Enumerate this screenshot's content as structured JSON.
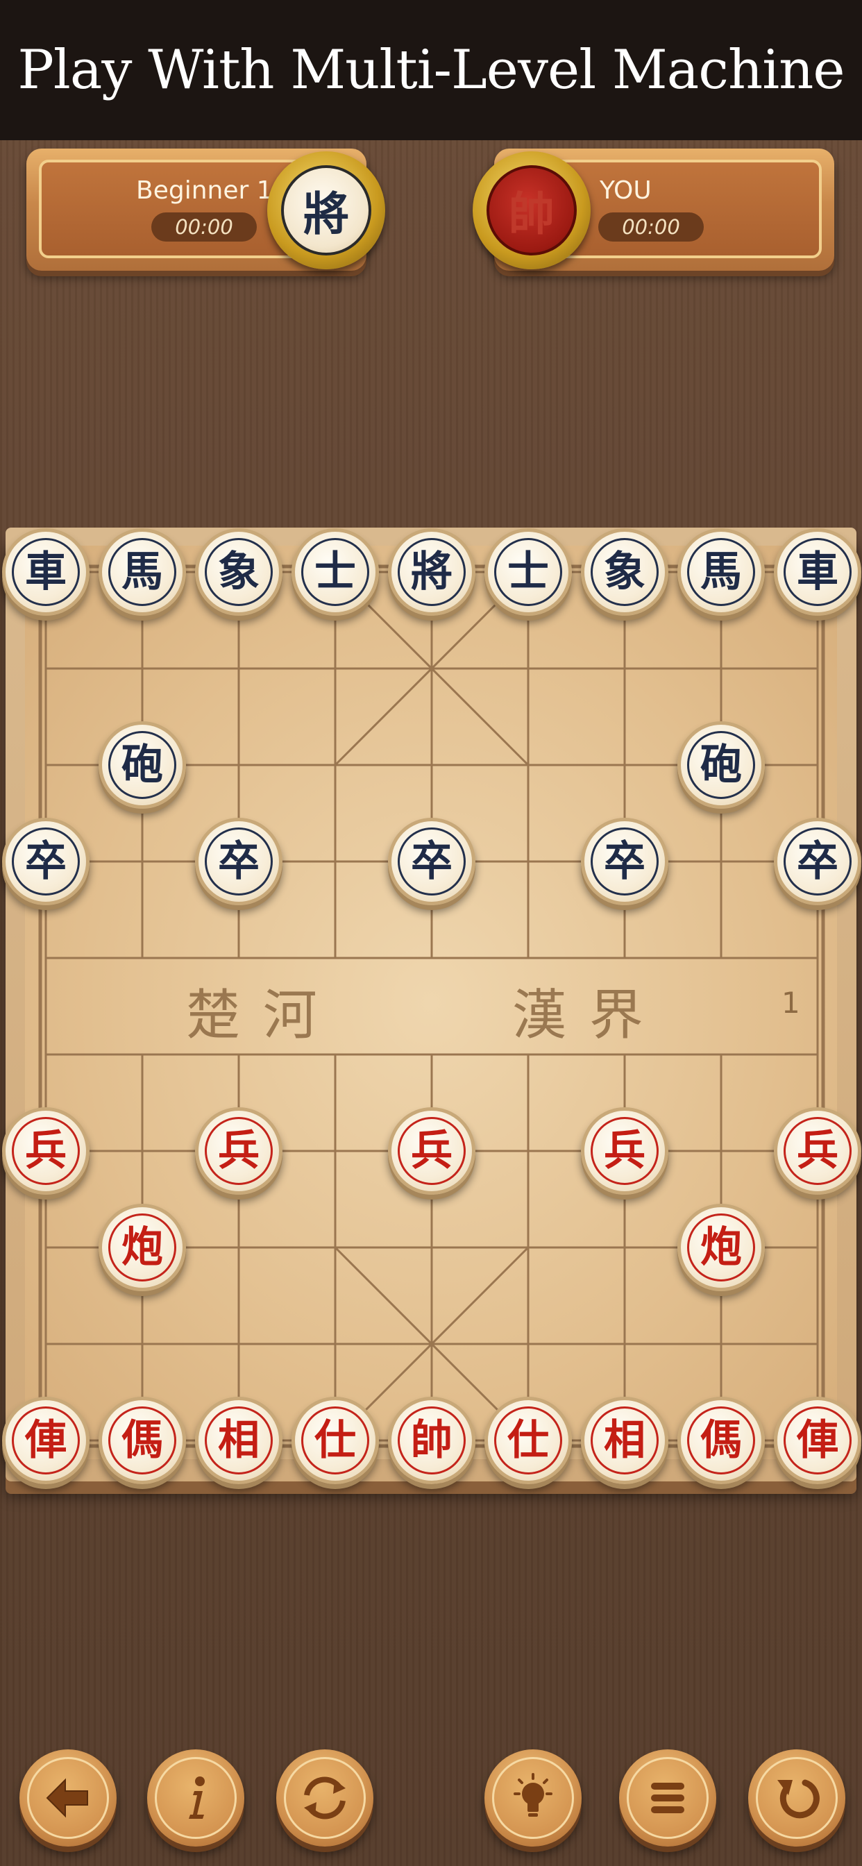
{
  "banner": {
    "title": "Play With Multi-Level Machine"
  },
  "opponent": {
    "name": "Beginner 1",
    "timer": "00:00",
    "avatar_char": "將"
  },
  "player": {
    "name": "YOU",
    "timer": "00:00",
    "avatar_char": "帥"
  },
  "board": {
    "river_left": "楚 河",
    "river_right": "漢 界",
    "move_count": "1",
    "pieces": [
      {
        "side": "black",
        "char": "車",
        "col": 0,
        "row": 0
      },
      {
        "side": "black",
        "char": "馬",
        "col": 1,
        "row": 0
      },
      {
        "side": "black",
        "char": "象",
        "col": 2,
        "row": 0
      },
      {
        "side": "black",
        "char": "士",
        "col": 3,
        "row": 0
      },
      {
        "side": "black",
        "char": "將",
        "col": 4,
        "row": 0
      },
      {
        "side": "black",
        "char": "士",
        "col": 5,
        "row": 0
      },
      {
        "side": "black",
        "char": "象",
        "col": 6,
        "row": 0
      },
      {
        "side": "black",
        "char": "馬",
        "col": 7,
        "row": 0
      },
      {
        "side": "black",
        "char": "車",
        "col": 8,
        "row": 0
      },
      {
        "side": "black",
        "char": "砲",
        "col": 1,
        "row": 2
      },
      {
        "side": "black",
        "char": "砲",
        "col": 7,
        "row": 2
      },
      {
        "side": "black",
        "char": "卒",
        "col": 0,
        "row": 3
      },
      {
        "side": "black",
        "char": "卒",
        "col": 2,
        "row": 3
      },
      {
        "side": "black",
        "char": "卒",
        "col": 4,
        "row": 3
      },
      {
        "side": "black",
        "char": "卒",
        "col": 6,
        "row": 3
      },
      {
        "side": "black",
        "char": "卒",
        "col": 8,
        "row": 3
      },
      {
        "side": "red",
        "char": "兵",
        "col": 0,
        "row": 6
      },
      {
        "side": "red",
        "char": "兵",
        "col": 2,
        "row": 6
      },
      {
        "side": "red",
        "char": "兵",
        "col": 4,
        "row": 6
      },
      {
        "side": "red",
        "char": "兵",
        "col": 6,
        "row": 6
      },
      {
        "side": "red",
        "char": "兵",
        "col": 8,
        "row": 6
      },
      {
        "side": "red",
        "char": "炮",
        "col": 1,
        "row": 7
      },
      {
        "side": "red",
        "char": "炮",
        "col": 7,
        "row": 7
      },
      {
        "side": "red",
        "char": "俥",
        "col": 0,
        "row": 9
      },
      {
        "side": "red",
        "char": "傌",
        "col": 1,
        "row": 9
      },
      {
        "side": "red",
        "char": "相",
        "col": 2,
        "row": 9
      },
      {
        "side": "red",
        "char": "仕",
        "col": 3,
        "row": 9
      },
      {
        "side": "red",
        "char": "帥",
        "col": 4,
        "row": 9
      },
      {
        "side": "red",
        "char": "仕",
        "col": 5,
        "row": 9
      },
      {
        "side": "red",
        "char": "相",
        "col": 6,
        "row": 9
      },
      {
        "side": "red",
        "char": "傌",
        "col": 7,
        "row": 9
      },
      {
        "side": "red",
        "char": "俥",
        "col": 8,
        "row": 9
      }
    ]
  },
  "toolbar": {
    "buttons": [
      {
        "name": "back",
        "icon": "arrow-left-icon"
      },
      {
        "name": "info",
        "icon": "info-icon"
      },
      {
        "name": "swap",
        "icon": "swap-icon"
      },
      {
        "name": "hint",
        "icon": "lightbulb-icon"
      },
      {
        "name": "menu",
        "icon": "menu-icon"
      },
      {
        "name": "undo",
        "icon": "undo-icon"
      }
    ]
  }
}
